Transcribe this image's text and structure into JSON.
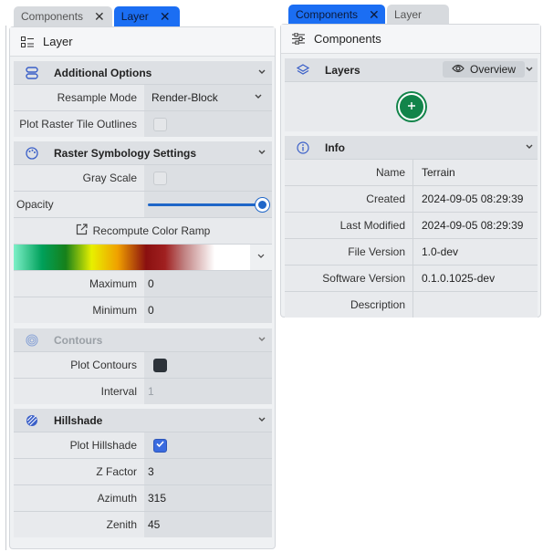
{
  "left": {
    "tabs": [
      {
        "label": "Components",
        "close": "✕"
      },
      {
        "label": "Layer",
        "close": "✕"
      }
    ],
    "header": {
      "title": "Layer"
    },
    "additional_options": {
      "title": "Additional Options",
      "resample_mode": {
        "label": "Resample Mode",
        "value": "Render-Block"
      },
      "plot_outlines": {
        "label": "Plot Raster Tile Outlines"
      }
    },
    "symbology": {
      "title": "Raster Symbology Settings",
      "gray_scale": {
        "label": "Gray Scale"
      },
      "opacity": {
        "label": "Opacity",
        "level": 1.0
      },
      "recompute": {
        "label": "Recompute Color Ramp"
      },
      "maximum": {
        "label": "Maximum",
        "value": "0"
      },
      "minimum": {
        "label": "Minimum",
        "value": "0"
      }
    },
    "contours": {
      "title": "Contours",
      "plot_contours": {
        "label": "Plot Contours"
      },
      "interval": {
        "label": "Interval",
        "value": "1"
      }
    },
    "hillshade": {
      "title": "Hillshade",
      "plot_hillshade": {
        "label": "Plot Hillshade"
      },
      "z_factor": {
        "label": "Z Factor",
        "value": "3"
      },
      "azimuth": {
        "label": "Azimuth",
        "value": "315"
      },
      "zenith": {
        "label": "Zenith",
        "value": "45"
      }
    }
  },
  "right": {
    "tabs": [
      {
        "label": "Components",
        "close": "✕"
      },
      {
        "label": "Layer"
      }
    ],
    "header": {
      "title": "Components"
    },
    "layers": {
      "title": "Layers",
      "overview": "Overview"
    },
    "info": {
      "title": "Info",
      "rows": [
        {
          "label": "Name",
          "value": "Terrain"
        },
        {
          "label": "Created",
          "value": "2024-09-05 08:29:39"
        },
        {
          "label": "Last Modified",
          "value": "2024-09-05 08:29:39"
        },
        {
          "label": "File Version",
          "value": "1.0-dev"
        },
        {
          "label": "Software Version",
          "value": "0.1.0.1025-dev"
        },
        {
          "label": "Description",
          "value": ""
        }
      ]
    }
  },
  "colors": {
    "accent": "#1b6ef3",
    "add_button": "#12844a",
    "checkbox_checked": "#3a6bdf"
  }
}
